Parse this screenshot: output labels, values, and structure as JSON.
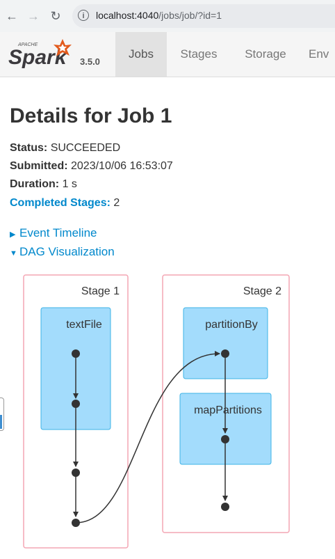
{
  "browser": {
    "back_glyph": "←",
    "forward_glyph": "→",
    "reload_glyph": "↻",
    "info_glyph": "i",
    "url_host": "localhost:4040",
    "url_path": "/jobs/job/?id=1"
  },
  "spark": {
    "version": "3.5.0",
    "logo_top_text": "APACHE",
    "logo_text": "Spark",
    "tabs": [
      "Jobs",
      "Stages",
      "Storage",
      "Env"
    ],
    "active_tab": "Jobs"
  },
  "job": {
    "title": "Details for Job 1",
    "status_label": "Status:",
    "status_value": "SUCCEEDED",
    "submitted_label": "Submitted:",
    "submitted_value": "2023/10/06 16:53:07",
    "duration_label": "Duration:",
    "duration_value": "1 s",
    "completed_label": "Completed Stages:",
    "completed_value": "2"
  },
  "toggles": {
    "event_timeline": "Event Timeline",
    "dag_visualization": "DAG Visualization",
    "collapsed_arrow": "▶",
    "expanded_arrow": "▼"
  },
  "dag": {
    "stages": [
      {
        "label": "Stage 1",
        "ops": [
          "textFile"
        ]
      },
      {
        "label": "Stage 2",
        "ops": [
          "partitionBy",
          "mapPartitions"
        ]
      }
    ],
    "colors": {
      "stage_border": "#f4a6b4",
      "op_fill": "#a3dcfc",
      "op_border": "#3eb3e6",
      "node": "#333333"
    }
  }
}
